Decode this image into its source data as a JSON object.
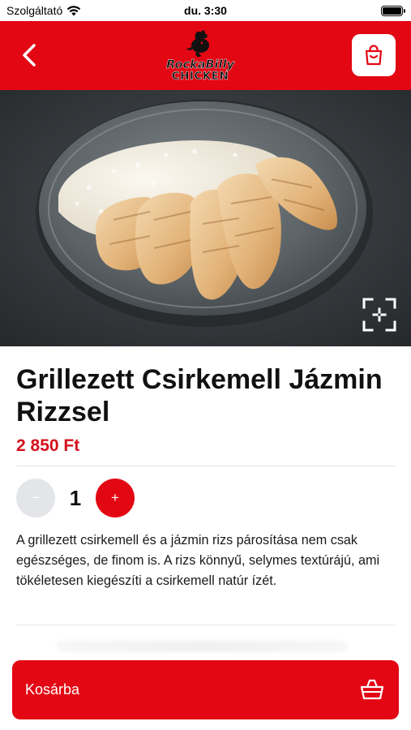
{
  "status_bar": {
    "carrier": "Szolgáltató",
    "time": "du. 3:30"
  },
  "header": {
    "brand_line1": "RockaBilly",
    "brand_line2": "CHICKEN",
    "accent_color": "#e30613"
  },
  "product": {
    "title": "Grillezett Csirkemell Jázmin Rizzsel",
    "price": "2 850 Ft",
    "quantity": "1",
    "minus_label": "−",
    "plus_label": "+",
    "description": "A grillezett csirkemell és a jázmin rizs párosítása nem csak egészséges, de finom is. A rizs könnyű, selymes textúrájú, ami tökéletesen kiegészíti a csirkemell natúr ízét."
  },
  "footer": {
    "add_to_cart_label": "Kosárba"
  },
  "icons": {
    "back": "chevron-left-icon",
    "cart": "shopping-bag-icon",
    "zoom": "fullscreen-icon",
    "basket": "basket-icon"
  }
}
